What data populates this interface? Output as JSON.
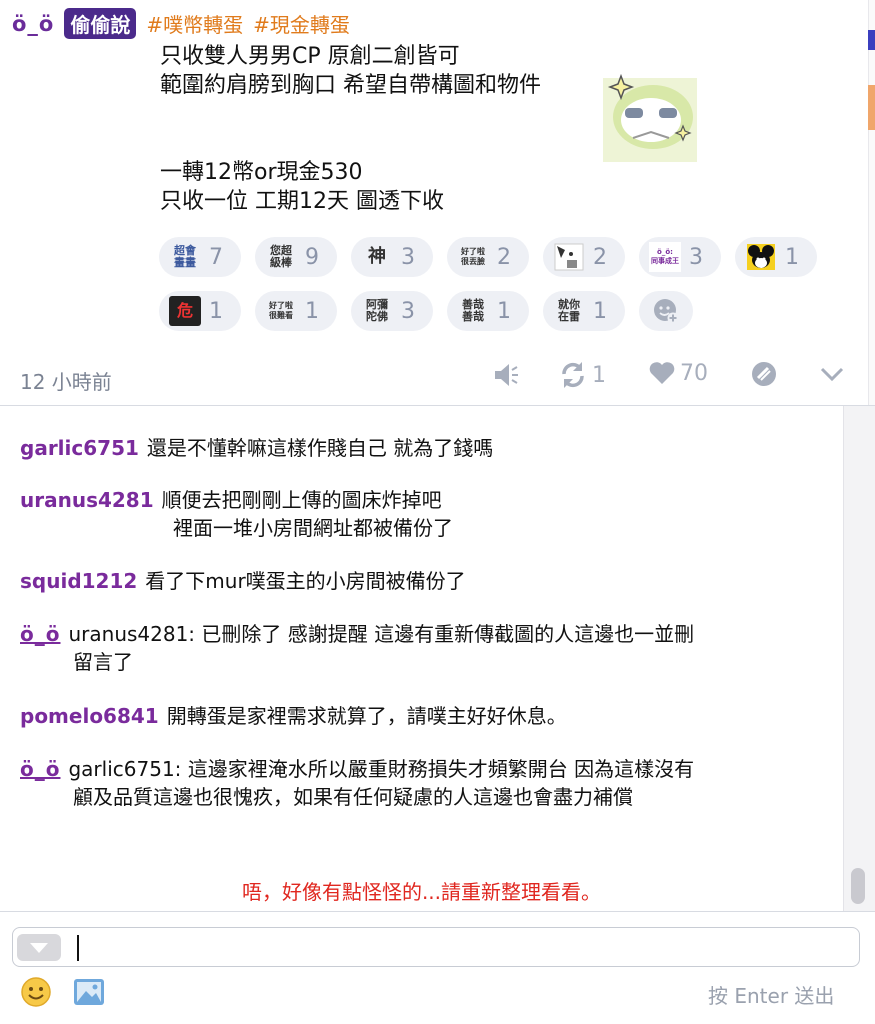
{
  "post": {
    "author": "ö_ö",
    "qualifier": "偷偷說",
    "hashtags": [
      "#噗幣轉蛋",
      "#現金轉蛋"
    ],
    "body": "只收雙人男男CP 原創二創皆可\n範圍約肩膀到胸口 希望自帶構圖和物件\n\n\n一轉12幣or現金530\n只收一位 工期12天 圖透下收",
    "reactions": [
      {
        "label": "超會\n畫畫",
        "count": "7",
        "icon": "sticker-text"
      },
      {
        "label": "您超\n級棒",
        "count": "9",
        "icon": "sticker-text"
      },
      {
        "label": "神",
        "count": "3",
        "icon": "sticker-text"
      },
      {
        "label": "好了啦\n很丟臉",
        "count": "2",
        "icon": "sticker-text"
      },
      {
        "label": "",
        "count": "2",
        "icon": "cat-sticker"
      },
      {
        "label": "ö_ö:\n同事成王",
        "count": "3",
        "icon": "sticker-text"
      },
      {
        "label": "",
        "count": "1",
        "icon": "cartoon-mouse-sticker"
      },
      {
        "label": "危",
        "count": "1",
        "icon": "danger-sticker"
      },
      {
        "label": "好了啦\n很難看",
        "count": "1",
        "icon": "sticker-text"
      },
      {
        "label": "阿彌\n陀佛",
        "count": "3",
        "icon": "sticker-text"
      },
      {
        "label": "善哉\n善哉",
        "count": "1",
        "icon": "sticker-text"
      },
      {
        "label": "就你\n在雷",
        "count": "1",
        "icon": "sticker-text"
      }
    ],
    "timestamp": "12 小時前",
    "replurk_count": "1",
    "like_count": "70"
  },
  "responses": [
    {
      "user": "garlic6751",
      "text": "還是不懂幹嘛這樣作賤自己 就為了錢嗎",
      "lines": [
        "還是不懂幹嘛這樣作賤自己 就為了錢嗎"
      ],
      "is_author": false
    },
    {
      "user": "uranus4281",
      "text": "順便去把剛剛上傳的圖床炸掉吧 裡面一堆小房間網址都被備份了",
      "lines": [
        "順便去把剛剛上傳的圖床炸掉吧",
        "裡面一堆小房間網址都被備份了"
      ],
      "is_author": false
    },
    {
      "user": "squid1212",
      "text": "看了下mur噗蛋主的小房間被備份了",
      "lines": [
        "看了下mur噗蛋主的小房間被備份了"
      ],
      "is_author": false
    },
    {
      "user": "ö_ö",
      "text": "uranus4281: 已刪除了 感謝提醒 這邊有重新傳截圖的人這邊也一並刪留言了",
      "lines": [
        "uranus4281: 已刪除了 感謝提醒 這邊有重新傳截圖的人這邊也一並刪",
        "留言了"
      ],
      "is_author": true
    },
    {
      "user": "pomelo6841",
      "text": "開轉蛋是家裡需求就算了，請噗主好好休息。",
      "lines": [
        "開轉蛋是家裡需求就算了，請噗主好好休息。"
      ],
      "is_author": false
    },
    {
      "user": "ö_ö",
      "text": "garlic6751: 這邊家裡淹水所以嚴重財務損失才頻繁開台 因為這樣沒有顧及品質這邊也很愧疚，如果有任何疑慮的人這邊也會盡力補償",
      "lines": [
        "garlic6751: 這邊家裡淹水所以嚴重財務損失才頻繁開台 因為這樣沒有",
        "顧及品質這邊也很愧疚，如果有任何疑慮的人這邊也會盡力補償"
      ],
      "is_author": true
    }
  ],
  "warning": "唔，好像有點怪怪的...請重新整理看看。",
  "composer": {
    "enter_hint": "按 Enter 送出"
  },
  "colors": {
    "username": "#7a2b9c",
    "hashtag": "#e07b1c",
    "warning": "#e0271f",
    "qualifier_bg": "#4b2a8b"
  }
}
